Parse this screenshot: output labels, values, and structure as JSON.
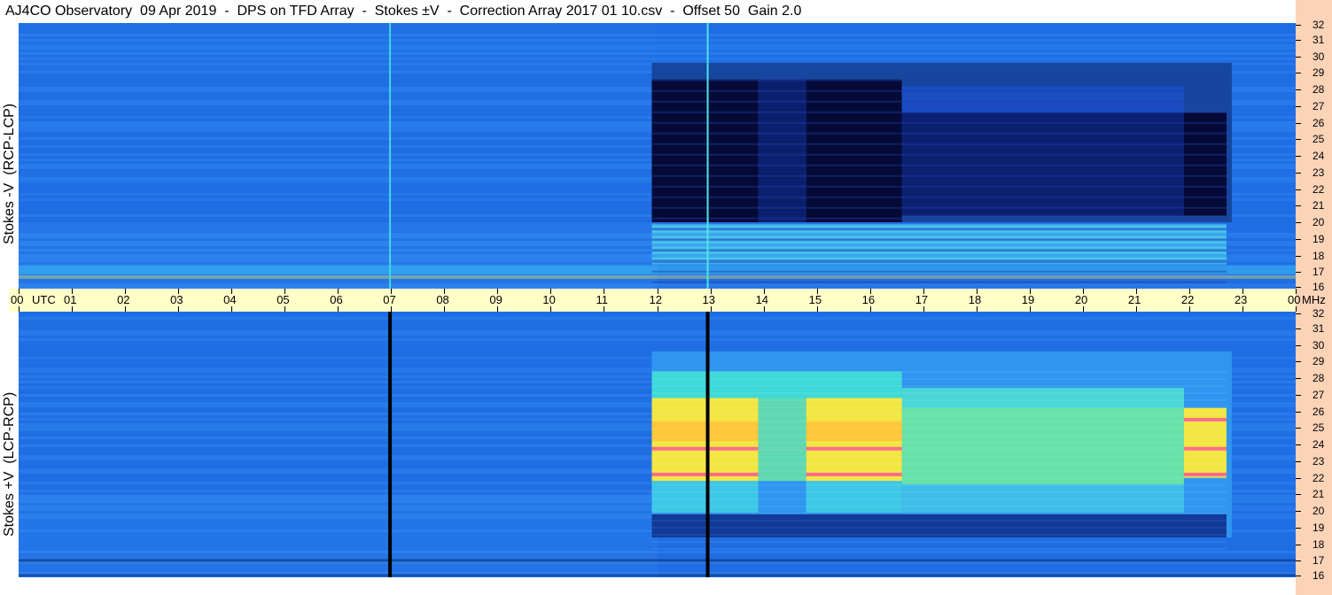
{
  "title": "AJ4CO Observatory  09 Apr 2019  -  DPS on TFD Array  -  Stokes ±V  -  Correction Array 2017 01 10.csv  -  Offset 50  Gain 2.0",
  "colors": {
    "background_field": "#1f6ee6",
    "axis_band": "#ffffc8",
    "right_strip": "#fbd3b7",
    "dark": "#040a35",
    "hot": "#ff6b8a",
    "warm": "#f5e83a",
    "cyan": "#3fe6d8"
  },
  "chart_data": [
    {
      "type": "heatmap",
      "panel": "top",
      "ylabel": "Stokes -V  (RCP-LCP)",
      "xlabel_unit": "UTC",
      "yunit": "MHz",
      "x_ticks": [
        "00",
        "01",
        "02",
        "03",
        "04",
        "05",
        "06",
        "07",
        "08",
        "09",
        "10",
        "11",
        "12",
        "13",
        "14",
        "15",
        "16",
        "17",
        "18",
        "19",
        "20",
        "21",
        "22",
        "23",
        "00"
      ],
      "y_ticks": [
        32,
        31,
        30,
        29,
        28,
        27,
        26,
        25,
        24,
        23,
        22,
        21,
        20,
        19,
        18,
        17,
        16
      ],
      "xlim_hours": [
        0,
        24
      ],
      "ylim_mhz": [
        16,
        32
      ],
      "features": [
        {
          "name": "dark-block",
          "x": [
            11.9,
            13.9
          ],
          "y": [
            20,
            28.6
          ],
          "level": "dark"
        },
        {
          "name": "dark-block",
          "x": [
            14.8,
            16.6
          ],
          "y": [
            20,
            28.6
          ],
          "level": "dark"
        },
        {
          "name": "dark-block",
          "x": [
            16.6,
            21.9
          ],
          "y": [
            20.4,
            26.6
          ],
          "level": "darkblue"
        },
        {
          "name": "dark-block",
          "x": [
            21.9,
            22.7
          ],
          "y": [
            20.4,
            26.6
          ],
          "level": "dark"
        },
        {
          "name": "bright-band",
          "x": [
            11.9,
            16.6
          ],
          "y": [
            16.6,
            19.8
          ],
          "level": "cyan"
        },
        {
          "name": "vertical-line",
          "x": [
            6.98
          ],
          "level": "cyan"
        },
        {
          "name": "vertical-line",
          "x": [
            12.95
          ],
          "level": "cyan"
        }
      ]
    },
    {
      "type": "heatmap",
      "panel": "bottom",
      "ylabel": "Stokes +V  (LCP-RCP)",
      "xlabel_unit": "UTC",
      "yunit": "MHz",
      "x_ticks": [
        "00",
        "01",
        "02",
        "03",
        "04",
        "05",
        "06",
        "07",
        "08",
        "09",
        "10",
        "11",
        "12",
        "13",
        "14",
        "15",
        "16",
        "17",
        "18",
        "19",
        "20",
        "21",
        "22",
        "23",
        "00"
      ],
      "y_ticks": [
        32,
        31,
        30,
        29,
        28,
        27,
        26,
        25,
        24,
        23,
        22,
        21,
        20,
        19,
        18,
        17,
        16
      ],
      "xlim_hours": [
        0,
        24
      ],
      "ylim_mhz": [
        16,
        32
      ],
      "features": [
        {
          "name": "warm-block",
          "x": [
            11.9,
            13.9
          ],
          "y": [
            21.8,
            26.8
          ],
          "level": "warm"
        },
        {
          "name": "warm-block",
          "x": [
            14.8,
            16.6
          ],
          "y": [
            21.8,
            26.8
          ],
          "level": "warm"
        },
        {
          "name": "warm-block",
          "x": [
            21.9,
            22.7
          ],
          "y": [
            22,
            26.2
          ],
          "level": "warm"
        },
        {
          "name": "green-block",
          "x": [
            16.6,
            21.9
          ],
          "y": [
            21.6,
            27.4
          ],
          "level": "green"
        },
        {
          "name": "hot-line",
          "y": [
            23.85,
            22.3
          ],
          "level": "hot"
        },
        {
          "name": "vertical-line",
          "x": [
            6.98
          ],
          "level": "dark"
        },
        {
          "name": "vertical-line",
          "x": [
            12.95
          ],
          "level": "dark"
        }
      ]
    }
  ]
}
